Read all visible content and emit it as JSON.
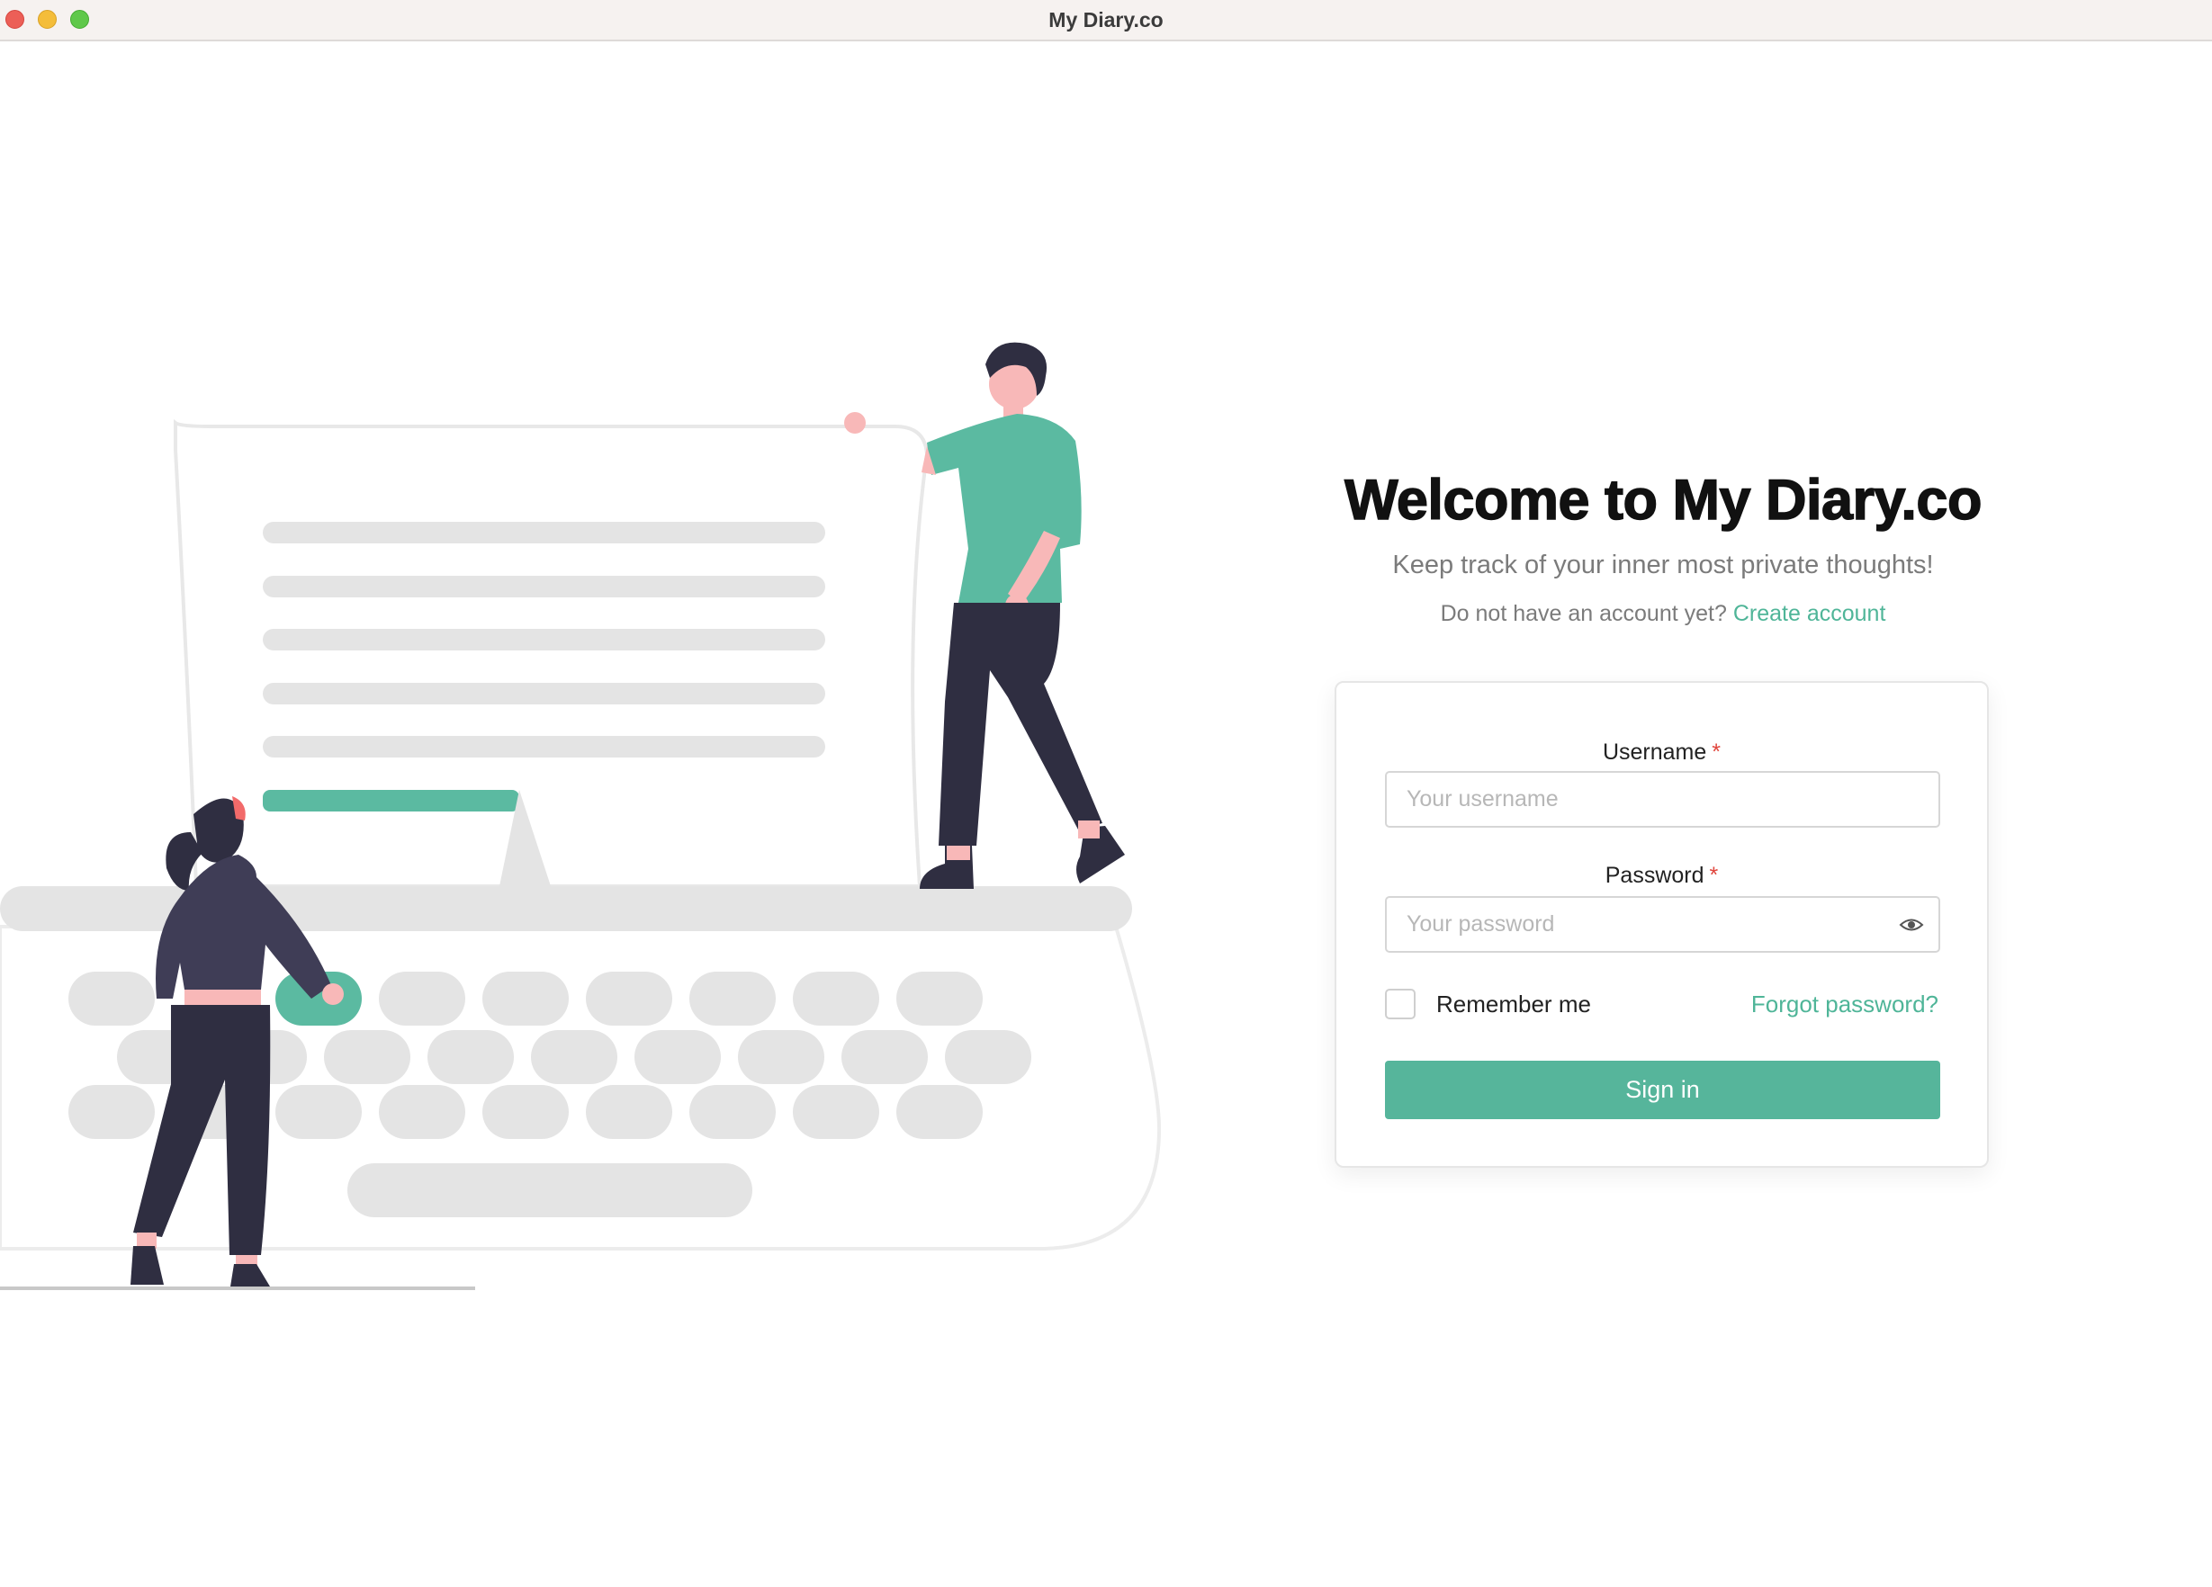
{
  "window": {
    "title": "My Diary.co"
  },
  "main": {
    "heading": "Welcome to My Diary.co",
    "subtitle": "Keep track of your inner most private thoughts!",
    "signup_prompt": "Do not have an account yet?",
    "signup_link": "Create account"
  },
  "form": {
    "username_label": "Username",
    "username_placeholder": "Your username",
    "password_label": "Password",
    "password_placeholder": "Your password",
    "required_mark": "*",
    "remember_label": "Remember me",
    "forgot_link": "Forgot password?",
    "signin_button": "Sign in"
  },
  "colors": {
    "accent": "#56b59b",
    "required": "#e0453c",
    "figure_dark": "#2f2e41",
    "skin": "#f8b8b8",
    "key_gray": "#e4e4e4"
  },
  "icons": {
    "password_toggle": "eye-icon",
    "illustration": "typewriter-illustration"
  }
}
